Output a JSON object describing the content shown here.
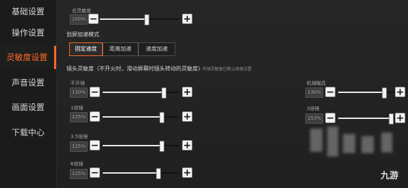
{
  "sidebar": {
    "items": [
      {
        "label": "基础设置"
      },
      {
        "label": "操作设置"
      },
      {
        "label": "灵敏度设置"
      },
      {
        "label": "声音设置"
      },
      {
        "label": "画面设置"
      },
      {
        "label": "下载中心"
      }
    ]
  },
  "main": {
    "total_sensitivity_label": "总灵敏度",
    "total_sensitivity_value": "100%",
    "speed_mode_title": "划屏加速模式",
    "speed_modes": [
      "固定速度",
      "距离加速",
      "速度加速"
    ],
    "camera_title": "镜头灵敏度（不开火时，滑动屏幕时镜头转动的灵敏度）",
    "camera_hint": "• 开镜灵敏度已默认保留设置",
    "sliders": [
      {
        "label": "不开镜",
        "value": "130%",
        "level": 0.79
      },
      {
        "label": "机械瞄具",
        "value": "130%",
        "level": 0.75
      },
      {
        "label": "1倍镜",
        "value": "125%",
        "level": 0.77
      },
      {
        "label": "3倍镜",
        "value": "153%",
        "level": 0.86
      },
      {
        "label": "3.5倍镜",
        "value": "125%",
        "level": 0.77
      },
      {
        "label": "6倍镜",
        "value": "125%",
        "level": 0.72
      }
    ],
    "total_level": 0.58
  },
  "watermark": {
    "text": "九游"
  },
  "colors": {
    "accent": "#ff6a23",
    "background": "#232323"
  },
  "icons": {
    "minus": "minus-icon",
    "plus": "plus-icon"
  }
}
